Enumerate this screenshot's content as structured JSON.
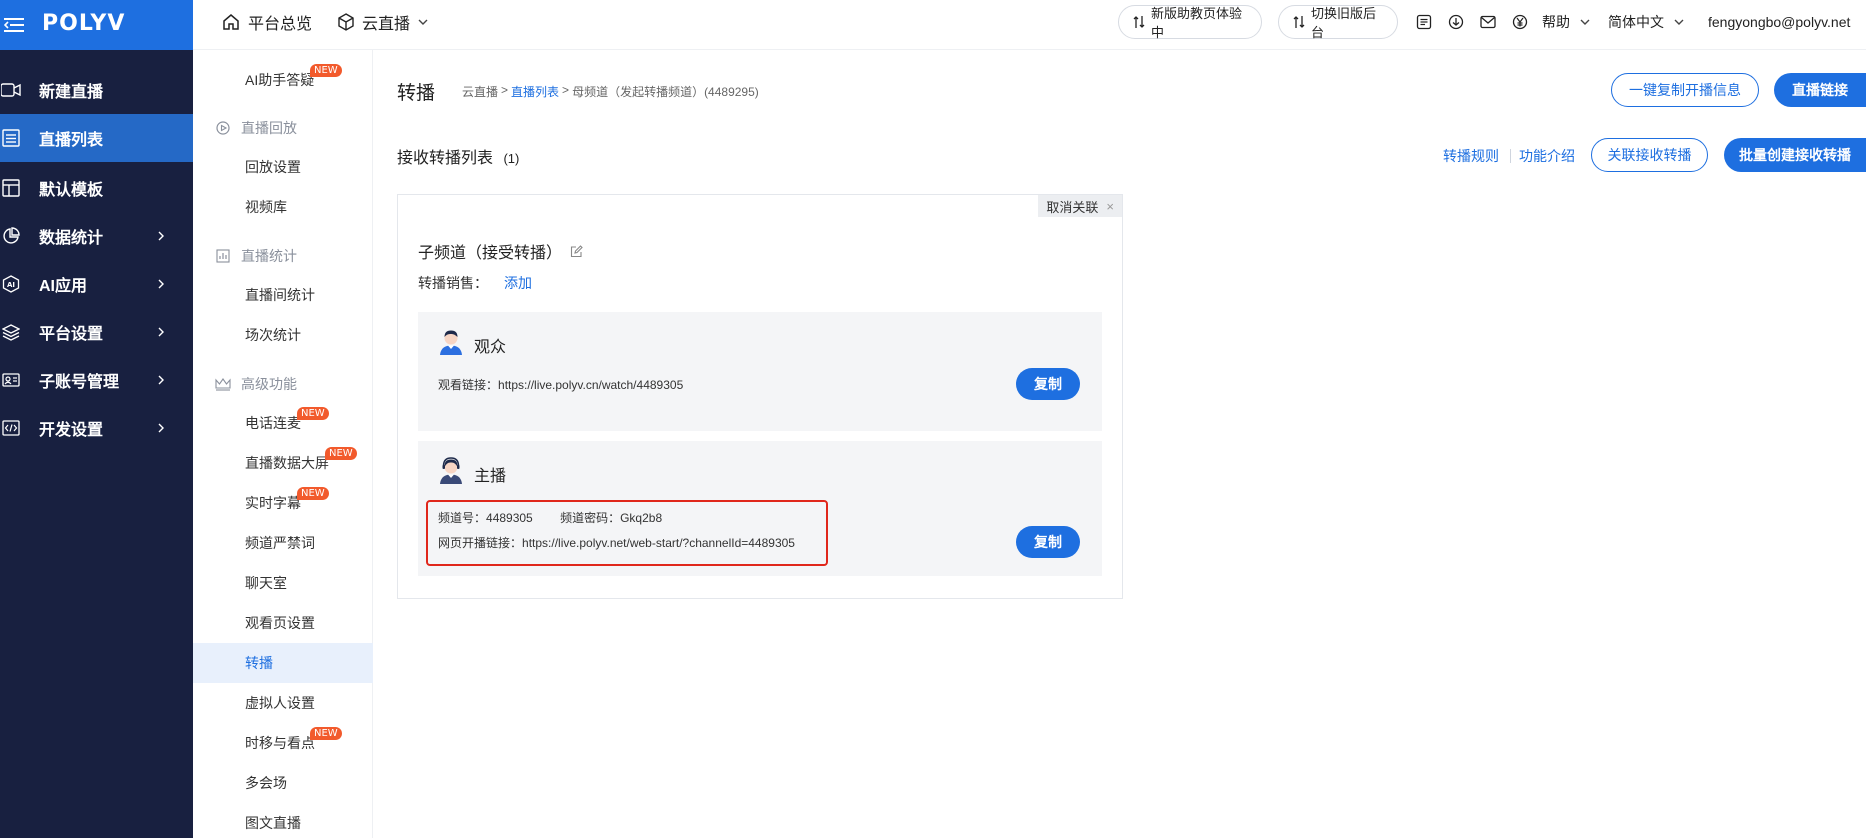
{
  "brand": {
    "logo": "POLYV",
    "accent": "#1e6fe0",
    "sidebar_bg": "#182040"
  },
  "topnav": {
    "overview": "平台总览",
    "cloud_live": "云直播",
    "new_teach_pill": "新版助教页体验中",
    "switch_old_pill": "切换旧版后台",
    "help": "帮助",
    "language": "简体中文",
    "user_email": "fengyongbo@polyv.net"
  },
  "sidebar": {
    "items": [
      {
        "label": "新建直播",
        "icon": "video-camera-icon"
      },
      {
        "label": "直播列表",
        "icon": "list-icon",
        "active": true
      },
      {
        "label": "默认模板",
        "icon": "template-icon"
      },
      {
        "label": "数据统计",
        "icon": "pie-chart-icon"
      },
      {
        "label": "AI应用",
        "icon": "ai-icon"
      },
      {
        "label": "平台设置",
        "icon": "layers-icon"
      },
      {
        "label": "子账号管理",
        "icon": "id-card-icon"
      },
      {
        "label": "开发设置",
        "icon": "code-icon"
      }
    ]
  },
  "subnav": {
    "ai_help": "AI助手答疑",
    "group_playback": "直播回放",
    "playback_settings": "回放设置",
    "video_library": "视频库",
    "group_stats": "直播统计",
    "room_stats": "直播间统计",
    "session_stats": "场次统计",
    "group_advanced": "高级功能",
    "phone_mic": "电话连麦",
    "data_screen": "直播数据大屏",
    "subtitles": "实时字幕",
    "banned_words": "频道严禁词",
    "chat_room": "聊天室",
    "watch_page": "观看页设置",
    "relay": "转播",
    "avatar_settings": "虚拟人设置",
    "timeshift": "时移与看点",
    "multi_venue": "多会场",
    "image_text": "图文直播",
    "new_badge": "NEW"
  },
  "main": {
    "title": "转播",
    "breadcrumb": {
      "root": "云直播",
      "sep1": ">",
      "list": "直播列表",
      "sep2": ">",
      "current": "母频道（发起转播频道）(4489295)"
    },
    "copy_info_button": "一键复制开播信息",
    "live_link_button": "直播链接",
    "section_title": "接收转播列表",
    "section_count": "(1)",
    "rules_link": "转播规则",
    "intro_link": "功能介绍",
    "associate_button": "关联接收转播",
    "batch_button": "批量创建接收转播",
    "card": {
      "unlink": "取消关联",
      "unlink_close": "×",
      "title": "子频道（接受转播）",
      "sale_label": "转播销售：",
      "sale_add": "添加",
      "viewer": {
        "role": "观众",
        "watch_label": "观看链接：",
        "watch_url": "https://live.polyv.cn/watch/4489305",
        "copy": "复制"
      },
      "host": {
        "role": "主播",
        "channel_label": "频道号：",
        "channel_id": "4489305",
        "password_label": "频道密码：",
        "password": "Gkq2b8",
        "web_start_label": "网页开播链接：",
        "web_start_url": "https://live.polyv.net/web-start/?channelId=4489305",
        "copy": "复制"
      }
    }
  }
}
